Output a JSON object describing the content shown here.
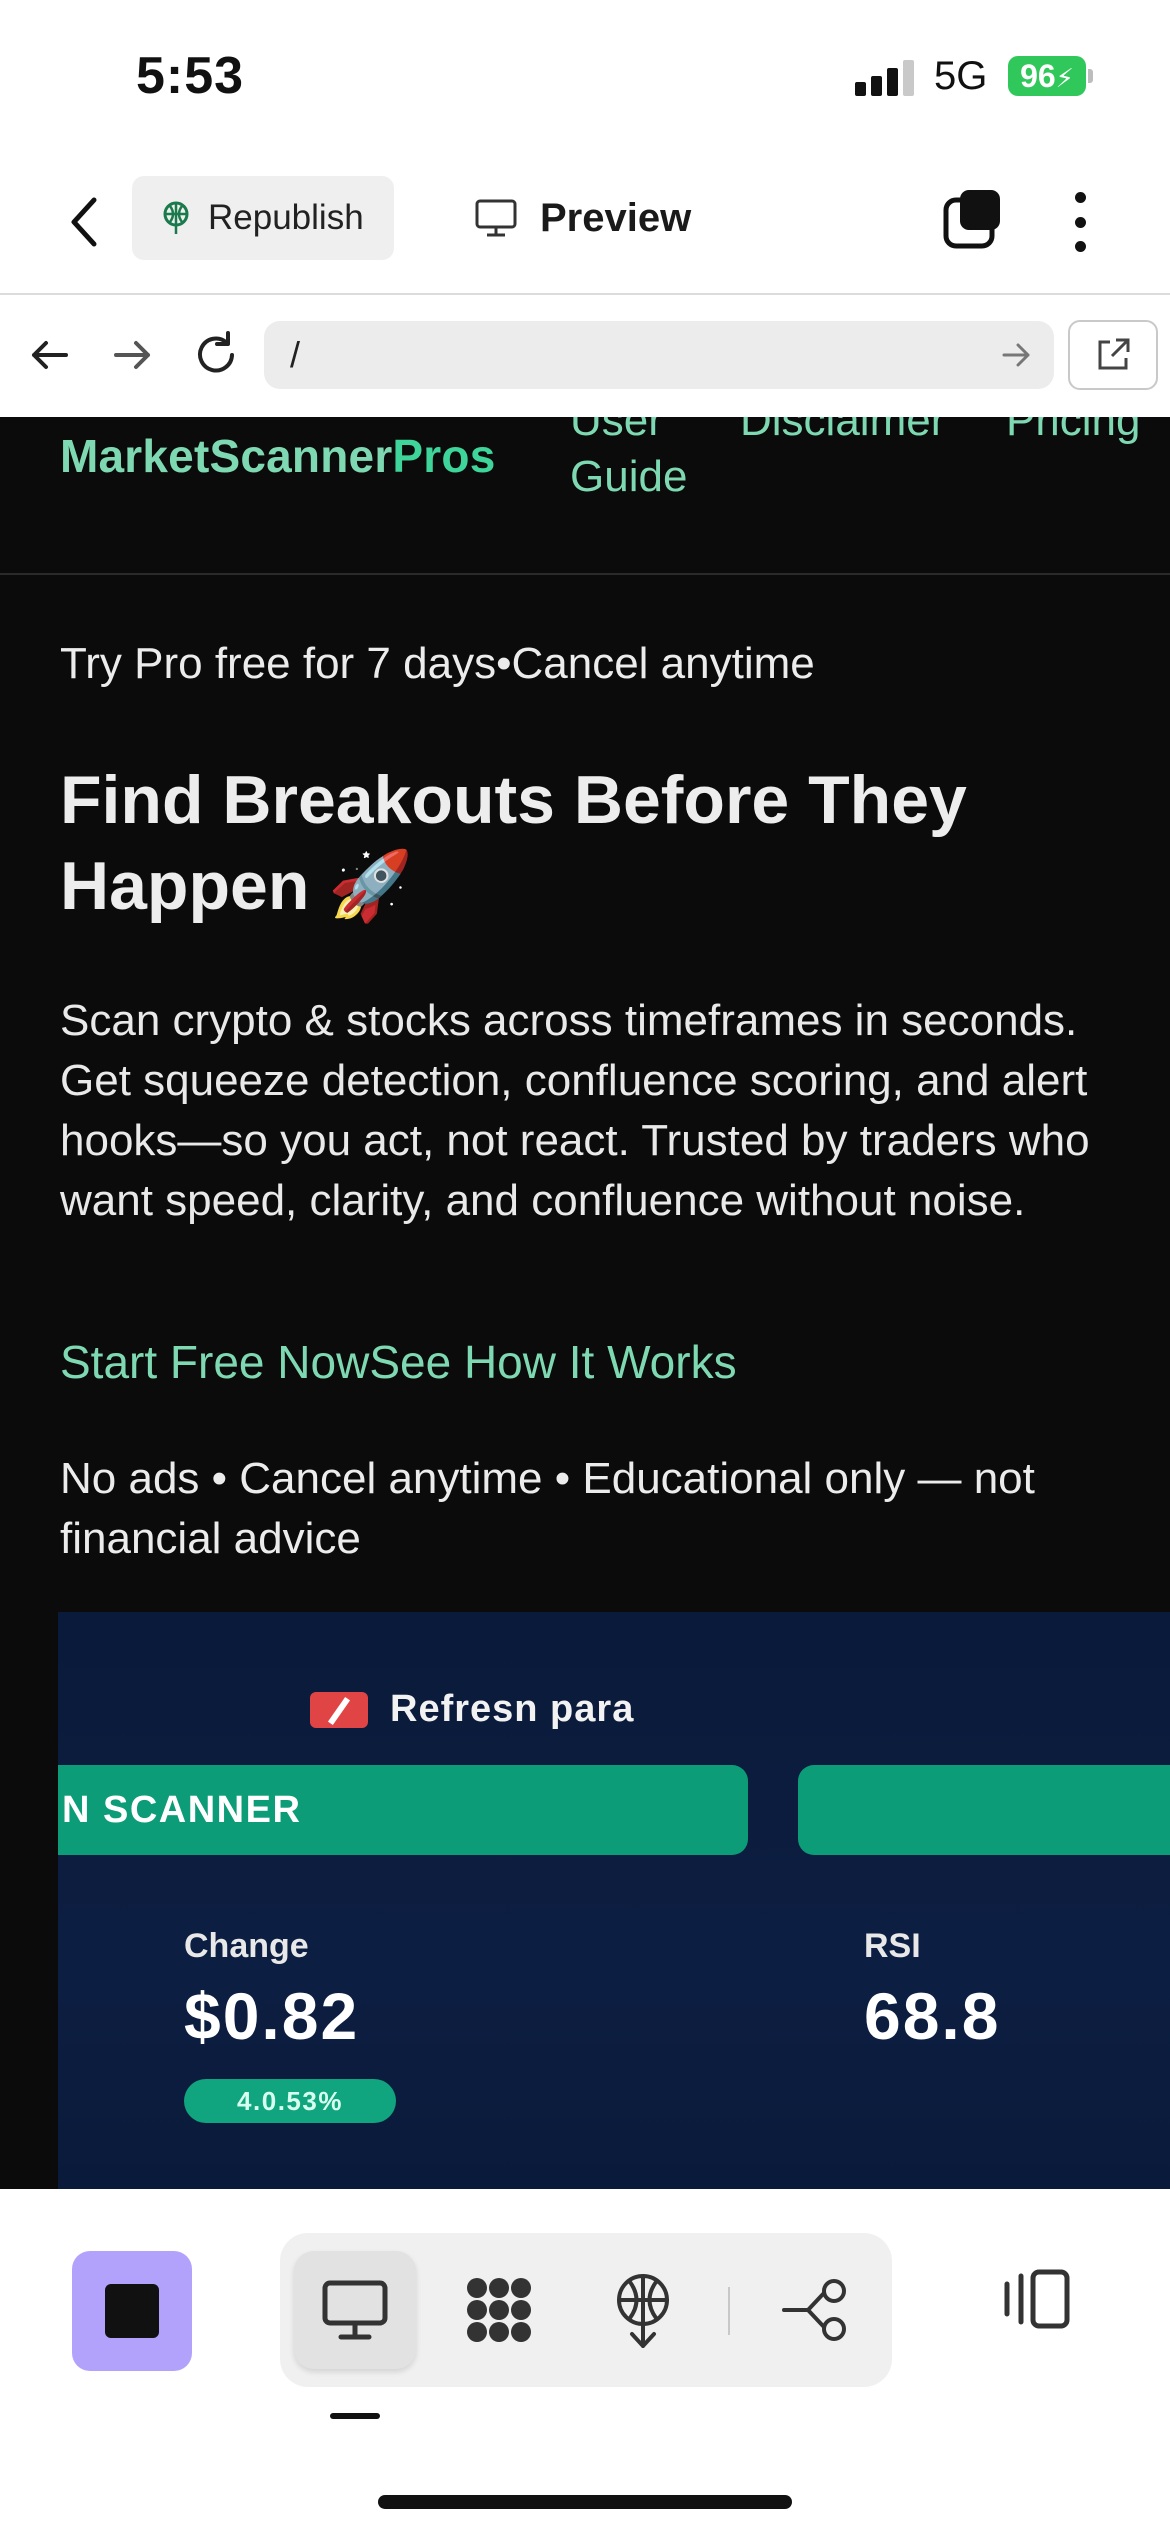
{
  "status_bar": {
    "time": "5:53",
    "network": "5G",
    "battery": "96"
  },
  "app_header": {
    "republish_label": "Republish",
    "preview_label": "Preview"
  },
  "browser": {
    "url": "/"
  },
  "site": {
    "brand_main": "MarketScanner",
    "brand_accent": "Pros",
    "nav": {
      "user_guide": "User Guide",
      "disclaimer": "Disclaimer",
      "pricing": "Pricing"
    },
    "trial_text": "Try Pro free for 7 days•Cancel anytime",
    "hero_title": "Find Breakouts Before They Happen 🚀",
    "hero_description": "Scan crypto & stocks across timeframes in seconds. Get squeeze detection, confluence scoring, and alert hooks—so you act, not react. Trusted by traders who want speed, clarity, and confluence without noise.",
    "cta_primary": "Start Free Now",
    "cta_secondary": "See How It Works",
    "fine_print": "No ads • Cancel anytime • Educational only — not financial advice",
    "colors": {
      "accent": "#7ed9b2",
      "background": "#0b0b0b"
    }
  },
  "scanner_preview": {
    "refresh_label": "Refresn para",
    "scan_button": "N SCANNER",
    "change_label": "Change",
    "change_value": "$0.82",
    "change_percent": "4.0.53%",
    "rsi_label": "RSI",
    "rsi_value": "68.8"
  },
  "bottom_toolbar": {
    "stop_color": "#b3a2fb",
    "tools": [
      "monitor-icon",
      "grid-blob-icon",
      "deploy-icon",
      "flow-icon"
    ],
    "active_tool": "monitor-icon"
  }
}
